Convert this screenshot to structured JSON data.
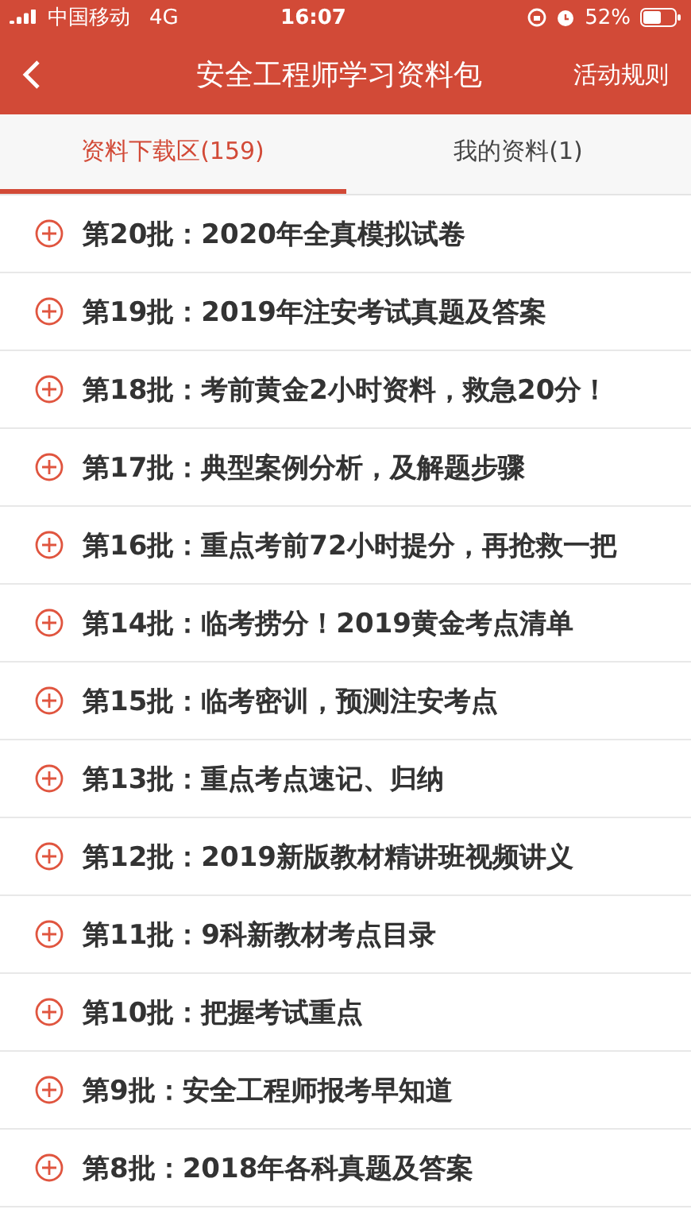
{
  "status_bar": {
    "carrier": "中国移动",
    "network": "4G",
    "time": "16:07",
    "battery": "52%"
  },
  "nav": {
    "title": "安全工程师学习资料包",
    "action": "活动规则"
  },
  "tabs": [
    {
      "label": "资料下载区(159)",
      "selected": true
    },
    {
      "label": "我的资料(1)",
      "selected": false
    }
  ],
  "items": [
    {
      "title": "第20批：2020年全真模拟试卷"
    },
    {
      "title": "第19批：2019年注安考试真题及答案"
    },
    {
      "title": "第18批：考前黄金2小时资料，救急20分！"
    },
    {
      "title": "第17批：典型案例分析，及解题步骤"
    },
    {
      "title": "第16批：重点考前72小时提分，再抢救一把"
    },
    {
      "title": "第14批：临考捞分！2019黄金考点清单"
    },
    {
      "title": "第15批：临考密训，预测注安考点"
    },
    {
      "title": "第13批：重点考点速记、归纳"
    },
    {
      "title": "第12批：2019新版教材精讲班视频讲义"
    },
    {
      "title": "第11批：9科新教材考点目录"
    },
    {
      "title": "第10批：把握考试重点"
    },
    {
      "title": "第9批：安全工程师报考早知道"
    },
    {
      "title": "第8批：2018年各科真题及答案"
    }
  ]
}
